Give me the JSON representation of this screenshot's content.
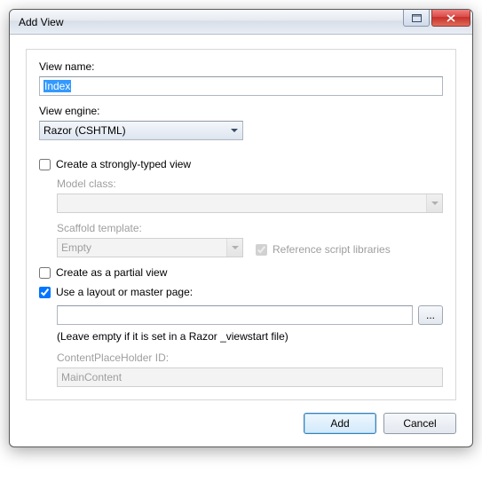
{
  "title": "Add View",
  "viewName": {
    "label": "View name:",
    "value": "Index"
  },
  "viewEngine": {
    "label": "View engine:",
    "selected": "Razor (CSHTML)"
  },
  "stronglyTyped": {
    "label": "Create a strongly-typed view",
    "checked": false
  },
  "modelClass": {
    "label": "Model class:",
    "value": ""
  },
  "scaffold": {
    "label": "Scaffold template:",
    "selected": "Empty"
  },
  "refScripts": {
    "label": "Reference script libraries",
    "checked": true
  },
  "partial": {
    "label": "Create as a partial view",
    "checked": false
  },
  "useLayout": {
    "label": "Use a layout or master page:",
    "checked": true,
    "value": ""
  },
  "layoutHint": "(Leave empty if it is set in a Razor _viewstart file)",
  "cph": {
    "label": "ContentPlaceHolder ID:",
    "value": "MainContent"
  },
  "browse": "...",
  "buttons": {
    "add": "Add",
    "cancel": "Cancel"
  }
}
